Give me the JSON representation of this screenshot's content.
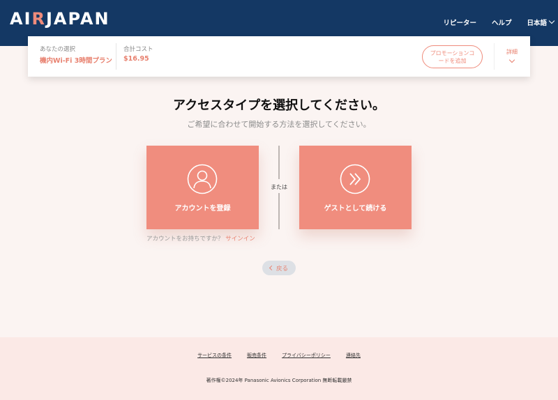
{
  "header": {
    "logo": {
      "part1": "AI",
      "part2": "R",
      "part3": "JAPAN"
    },
    "nav": {
      "repeater": "リピーター",
      "help": "ヘルプ",
      "language": "日本語"
    }
  },
  "summary": {
    "selection_label": "あなたの選択",
    "selection_value": "機内Wi-Fi 3時間プラン",
    "total_label": "合計コスト",
    "total_value": "$16.95",
    "promo_button": "プロモーションコードを追加",
    "details_label": "詳細"
  },
  "main": {
    "title": "アクセスタイプを選択してください。",
    "subtitle": "ご希望に合わせて開始する方法を選択してください。",
    "register_card": "アカウントを登録",
    "or_text": "または",
    "guest_card": "ゲストとして続ける",
    "signin_prompt": "アカウントをお持ちですか？",
    "signin_link": "サインイン",
    "back_button": "戻る"
  },
  "footer": {
    "links": [
      "サービスの条件",
      "販売条件",
      "プライバシーポリシー",
      "連絡先"
    ],
    "copyright": "著作権©2024年 Panasonic Avionics Corporation 無断転載厳禁"
  },
  "colors": {
    "header_bg": "#143864",
    "accent": "#f08d7e",
    "page_bg": "#fbf4f2",
    "footer_bg": "#fbe9e6"
  }
}
